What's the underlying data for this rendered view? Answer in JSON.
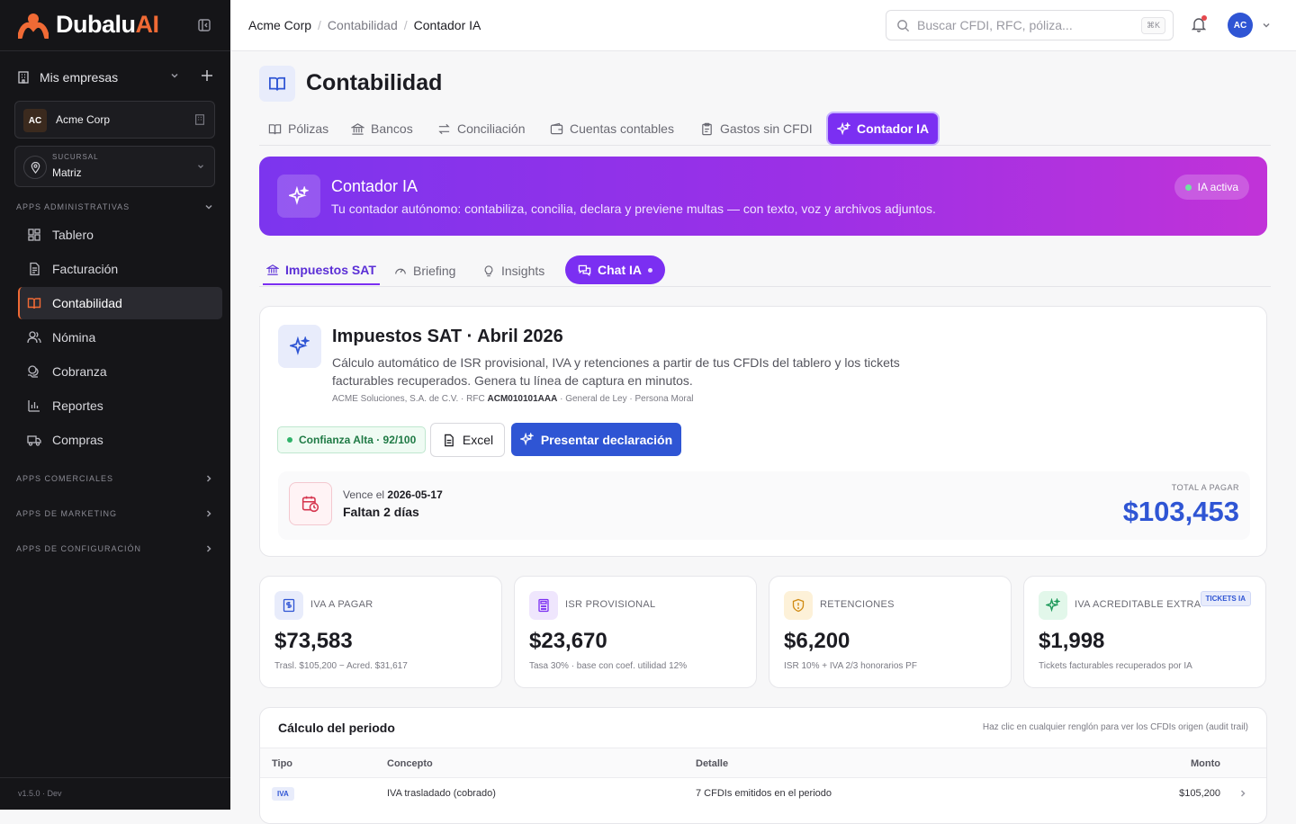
{
  "sidebar": {
    "logo": {
      "brand": "Dubalu",
      "suffix": "AI"
    },
    "companies_label": "Mis empresas",
    "company": {
      "initials": "AC",
      "name": "Acme Corp"
    },
    "branch": {
      "label": "SUCURSAL",
      "value": "Matriz"
    },
    "sections": [
      {
        "title": "APPS ADMINISTRATIVAS"
      },
      {
        "title": "APPS COMERCIALES"
      },
      {
        "title": "APPS DE MARKETING"
      },
      {
        "title": "APPS DE CONFIGURACIÓN"
      }
    ],
    "items": [
      {
        "label": "Tablero",
        "icon": "dashboard-icon"
      },
      {
        "label": "Facturación",
        "icon": "invoice-icon"
      },
      {
        "label": "Contabilidad",
        "icon": "book-icon",
        "active": true
      },
      {
        "label": "Nómina",
        "icon": "people-icon"
      },
      {
        "label": "Cobranza",
        "icon": "coins-icon"
      },
      {
        "label": "Reportes",
        "icon": "bar-chart-icon"
      },
      {
        "label": "Compras",
        "icon": "truck-icon"
      }
    ],
    "version": "v1.5.0 · Dev"
  },
  "topbar": {
    "breadcrumb": [
      "Acme Corp",
      "Contabilidad",
      "Contador IA"
    ],
    "search_placeholder": "Buscar CFDI, RFC, póliza...",
    "search_shortcut": "⌘K",
    "avatar": "AC"
  },
  "page": {
    "title": "Contabilidad",
    "tabs": [
      {
        "label": "Pólizas"
      },
      {
        "label": "Bancos"
      },
      {
        "label": "Conciliación"
      },
      {
        "label": "Cuentas contables"
      },
      {
        "label": "Gastos sin CFDI"
      },
      {
        "label": "Contador IA",
        "active": true
      }
    ]
  },
  "banner": {
    "title": "Contador IA",
    "subtitle": "Tu contador autónomo: contabiliza, concilia, declara y previene multas — con texto, voz y archivos adjuntos.",
    "status": "IA activa"
  },
  "subtabs": [
    {
      "label": "Impuestos SAT",
      "active": true
    },
    {
      "label": "Briefing"
    },
    {
      "label": "Insights"
    },
    {
      "label": "Chat IA"
    }
  ],
  "tax_card": {
    "title": "Impuestos SAT · Abril 2026",
    "description": "Cálculo automático de ISR provisional, IVA y retenciones a partir de tus CFDIs del tablero y los tickets facturables recuperados. Genera tu línea de captura en minutos.",
    "meta_company": "ACME Soluciones, S.A. de C.V.",
    "meta_rfc_label": "RFC",
    "meta_rfc": "ACM010101AAA",
    "meta_regime": "General de Ley · Persona Moral",
    "confidence": "Confianza Alta · 92/100",
    "excel_label": "Excel",
    "submit_label": "Presentar declaración",
    "due_prefix": "Vence el",
    "due_date": "2026-05-17",
    "due_remaining": "Faltan 2 días",
    "total_label": "TOTAL A PAGAR",
    "total_value": "$103,453"
  },
  "kpis": [
    {
      "label": "IVA A PAGAR",
      "value": "$73,583",
      "note": "Trasl. $105,200 − Acred. $31,617",
      "color": "#2f55d4",
      "bg": "#e8ecfb"
    },
    {
      "label": "ISR PROVISIONAL",
      "value": "$23,670",
      "note": "Tasa 30% · base con coef. utilidad 12%",
      "color": "#7b2ff2",
      "bg": "#efe6fd"
    },
    {
      "label": "RETENCIONES",
      "value": "$6,200",
      "note": "ISR 10% + IVA 2/3 honorarios PF",
      "color": "#d08a12",
      "bg": "#fdf1d8"
    },
    {
      "label": "IVA ACREDITABLE EXTRA",
      "value": "$1,998",
      "note": "Tickets facturables recuperados por IA",
      "badge": "TICKETS IA",
      "color": "#1f9a5b",
      "bg": "#e2f7ea"
    }
  ],
  "calc": {
    "title": "Cálculo del periodo",
    "hint": "Haz clic en cualquier renglón para ver los CFDIs origen (audit trail)",
    "headers": [
      "Tipo",
      "Concepto",
      "Detalle",
      "Monto"
    ],
    "rows": [
      {
        "tipo": "IVA",
        "concepto": "IVA trasladado (cobrado)",
        "detalle": "7 CFDIs emitidos en el periodo",
        "monto": "$105,200"
      }
    ]
  }
}
